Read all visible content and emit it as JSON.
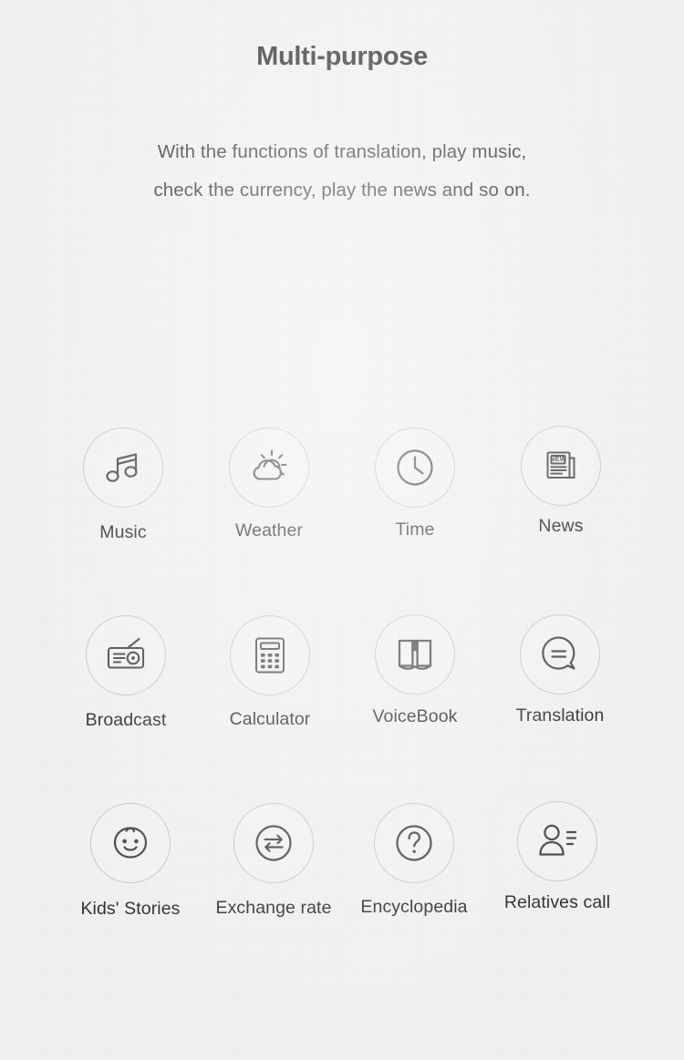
{
  "header": {
    "title": "Multi-purpose",
    "subtitle_lines": [
      "With the functions of translation, play music,",
      "check the currency, play the news and so on."
    ]
  },
  "colors": {
    "background": "#f2f2f2",
    "title": "#2b2b2b",
    "body_text": "#3a3a3a",
    "label": "#303030",
    "circle_border": "#c9c9c9",
    "icon_stroke": "#4a4a4a"
  },
  "features": {
    "rows": [
      {
        "items": [
          {
            "label": "Music",
            "icon": "music-note-icon"
          },
          {
            "label": "Weather",
            "icon": "sun-behind-cloud-icon"
          },
          {
            "label": "Time",
            "icon": "clock-icon"
          },
          {
            "label": "News",
            "icon": "newspaper-icon",
            "badge_text": "NEW"
          }
        ]
      },
      {
        "items": [
          {
            "label": "Broadcast",
            "icon": "radio-icon"
          },
          {
            "label": "Calculator",
            "icon": "calculator-icon"
          },
          {
            "label": "VoiceBook",
            "icon": "open-book-icon"
          },
          {
            "label": "Translation",
            "icon": "speech-bubble-equals-icon"
          }
        ]
      },
      {
        "items": [
          {
            "label": "Kids' Stories",
            "icon": "baby-face-icon"
          },
          {
            "label": "Exchange rate",
            "icon": "exchange-arrows-icon"
          },
          {
            "label": "Encyclopedia",
            "icon": "question-mark-circle-icon"
          },
          {
            "label": "Relatives call",
            "icon": "contact-person-icon"
          }
        ]
      }
    ]
  }
}
